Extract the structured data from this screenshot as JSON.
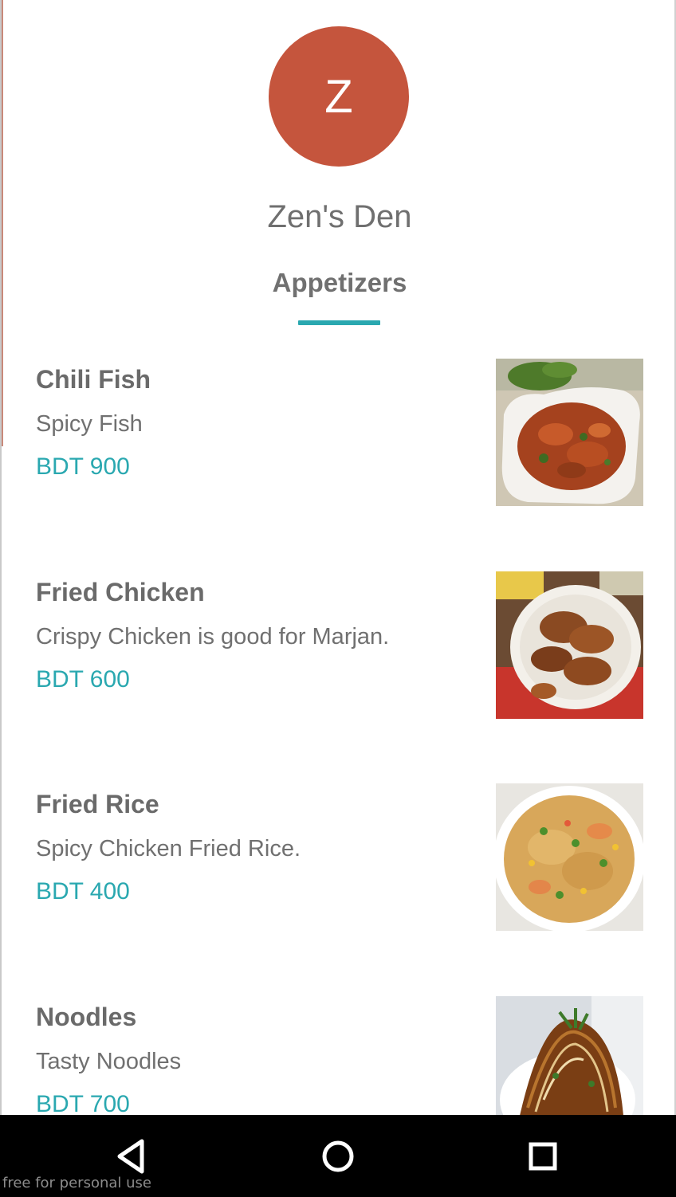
{
  "restaurant": {
    "avatar_letter": "Z",
    "name": "Zen's Den",
    "avatar_color": "#c5553d"
  },
  "category_tab": {
    "label": "Appetizers",
    "accent_color": "#2aa8b0"
  },
  "menu": {
    "items": [
      {
        "name": "Chili Fish",
        "description": "Spicy Fish",
        "price": "BDT 900",
        "image_icon": "chili-fish-photo"
      },
      {
        "name": "Fried Chicken",
        "description": "Crispy Chicken is good for Marjan.",
        "price": "BDT 600",
        "image_icon": "fried-chicken-photo"
      },
      {
        "name": "Fried Rice",
        "description": "Spicy Chicken Fried Rice.",
        "price": "BDT 400",
        "image_icon": "fried-rice-photo"
      },
      {
        "name": "Noodles",
        "description": "Tasty Noodles",
        "price": "BDT 700",
        "image_icon": "noodles-photo"
      }
    ]
  },
  "nav_bar": {
    "back_icon": "back-triangle-icon",
    "home_icon": "home-circle-icon",
    "recents_icon": "recents-square-icon"
  },
  "watermark": "free for personal use"
}
